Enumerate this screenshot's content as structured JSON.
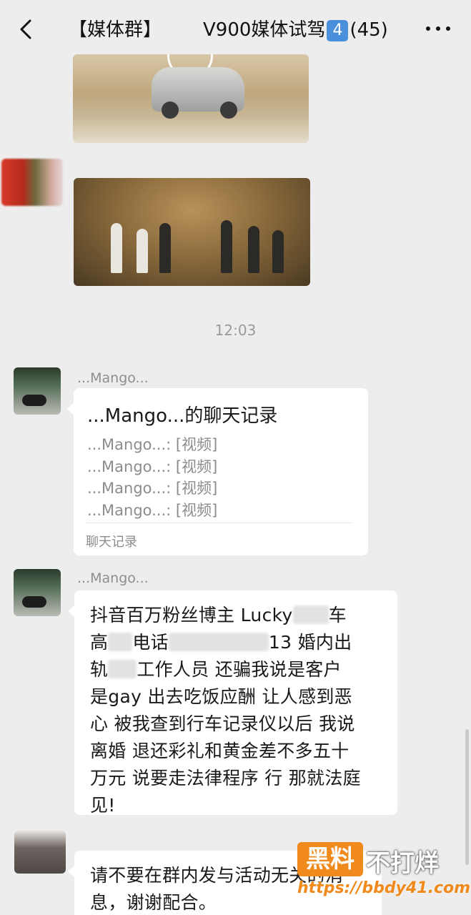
{
  "header": {
    "title_prefix": "【媒体群】",
    "title_suffix": "V900媒体试驾",
    "badge": "4",
    "member_count": "(45)"
  },
  "time_divider": "12:03",
  "messages": [
    {
      "sender": "...Mango...",
      "type": "chat_record",
      "title": "...Mango...的聊天记录",
      "lines": [
        "...Mango...: [视频]",
        "...Mango...: [视频]",
        "...Mango...: [视频]",
        "...Mango...: [视频]"
      ],
      "footer": "聊天记录"
    },
    {
      "sender": "...Mango...",
      "type": "text",
      "lines": [
        {
          "a": "抖音百万粉丝博主 Lucky",
          "b": "车"
        },
        {
          "a": "高",
          "b": "电话",
          "c": "13 婚内出"
        },
        {
          "a": "轨",
          "b": "工作人员 还骗我说是客户"
        },
        {
          "a": "是gay 出去吃饭应酬 让人感到恶"
        },
        {
          "a": "心 被我查到行车记录仪以后 我说"
        },
        {
          "a": "离婚 退还彩礼和黄金差不多五十"
        },
        {
          "a": "万元 说要走法律程序 行 那就法庭"
        },
        {
          "a": "见!"
        }
      ]
    },
    {
      "type": "text",
      "lines": [
        "请不要在群内发与活动无关的消",
        "息，谢谢配合。"
      ]
    }
  ],
  "watermark": {
    "box": "黑料",
    "text": "不打烊",
    "url": "https://bbdy41.com"
  }
}
